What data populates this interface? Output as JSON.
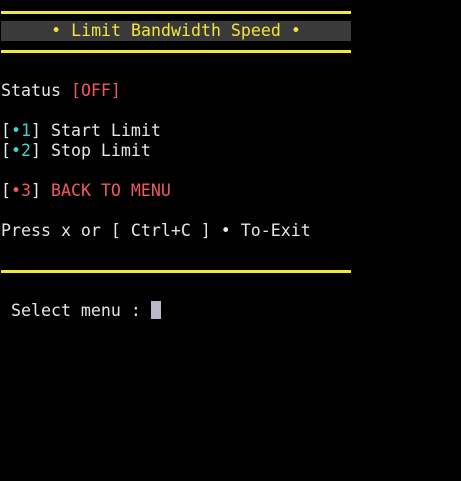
{
  "header": {
    "title": "• Limit Bandwidth Speed •"
  },
  "status": {
    "label": "Status",
    "value": "[OFF]"
  },
  "menu": {
    "items": [
      {
        "open": "[",
        "marker": "•1",
        "close": "]",
        "label": "Start Limit"
      },
      {
        "open": "[",
        "marker": "•2",
        "close": "]",
        "label": "Stop Limit"
      },
      {
        "open": "[",
        "marker": "•3",
        "close": "]",
        "label": "BACK TO MENU"
      }
    ]
  },
  "exit_hint": "Press x or [ Ctrl+C ] • To-Exit",
  "prompt": {
    "label": "Select menu : "
  },
  "colors": {
    "yellow": "#f2e63a",
    "cyan": "#3dd6d0",
    "red": "#f05a5a",
    "text": "#e6e6e6",
    "title_bg": "#3a3a3a"
  }
}
